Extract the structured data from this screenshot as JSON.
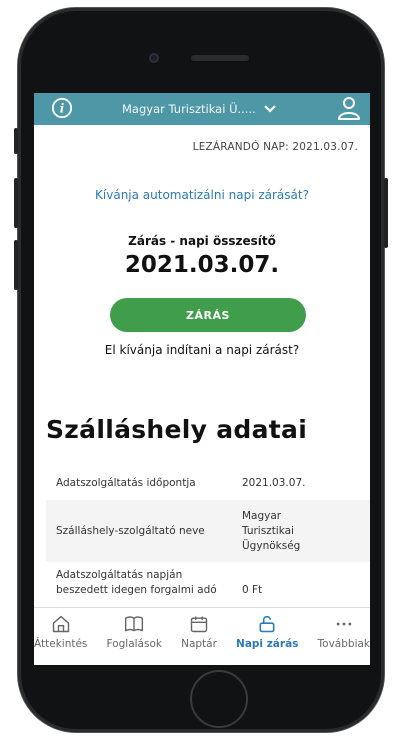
{
  "header": {
    "org_name": "Magyar Turisztikai Ü.....",
    "closing_day": "LEZÁRANDÓ NAP: 2021.03.07."
  },
  "main": {
    "automate_link": "Kívánja automatizálni napi zárását?",
    "summary_label": "Zárás - napi összesítő",
    "summary_date": "2021.03.07.",
    "close_button": "ZÁRÁS",
    "close_question": "El kívánja indítani a napi zárást?"
  },
  "accommodation": {
    "title": "Szálláshely adatai",
    "rows": [
      {
        "label": "Adatszolgáltatás időpontja",
        "value": "2021.03.07."
      },
      {
        "label": "Szálláshely-szolgáltató neve",
        "value": "Magyar\nTurisztikai\nÜgynökség"
      },
      {
        "label": "Adatszolgáltatás napján beszedett idegen forgalmi adó",
        "value": "0 Ft"
      }
    ]
  },
  "nav": [
    {
      "label": "Áttekintés",
      "icon": "home-icon"
    },
    {
      "label": "Foglalások",
      "icon": "book-icon"
    },
    {
      "label": "Naptár",
      "icon": "calendar-icon"
    },
    {
      "label": "Napi zárás",
      "icon": "unlock-icon"
    },
    {
      "label": "Továbbiak",
      "icon": "more-icon"
    }
  ],
  "colors": {
    "header": "#4e97a7",
    "button": "#3f9d4b",
    "link": "#2b79b6"
  }
}
